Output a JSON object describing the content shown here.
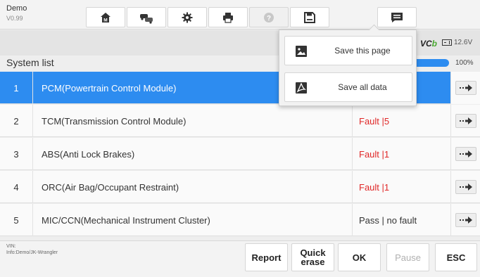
{
  "header": {
    "app_title": "Demo",
    "version": "V0.99",
    "toolbar": [
      {
        "name": "home-button",
        "icon": "home-icon"
      },
      {
        "name": "vehicle-swap-button",
        "icon": "vehicle-swap-icon"
      },
      {
        "name": "settings-button",
        "icon": "gear-icon"
      },
      {
        "name": "print-button",
        "icon": "printer-icon"
      },
      {
        "name": "help-button",
        "icon": "help-icon",
        "disabled": true
      },
      {
        "name": "save-button",
        "icon": "save-icon",
        "active": true
      },
      {
        "name": "message-button",
        "icon": "message-icon"
      }
    ]
  },
  "status": {
    "vci_label_vc": "VC",
    "vci_label_b": "b",
    "voltage": "12.6V",
    "progress_fraction": 1.0,
    "progress_text": "100%"
  },
  "section_title": "System list",
  "systems": [
    {
      "num": "1",
      "name": "PCM(Powertrain Control Module)",
      "status": "",
      "status_type": "",
      "selected": true
    },
    {
      "num": "2",
      "name": "TCM(Transmission Control Module)",
      "status": "Fault |5",
      "status_type": "fault",
      "selected": false
    },
    {
      "num": "3",
      "name": "ABS(Anti Lock Brakes)",
      "status": "Fault |1",
      "status_type": "fault",
      "selected": false
    },
    {
      "num": "4",
      "name": "ORC(Air Bag/Occupant Restraint)",
      "status": "Fault |1",
      "status_type": "fault",
      "selected": false
    },
    {
      "num": "5",
      "name": "MIC/CCN(Mechanical Instrument Cluster)",
      "status": "Pass | no fault",
      "status_type": "pass",
      "selected": false
    }
  ],
  "save_popup": {
    "save_page_label": "Save this page",
    "save_all_label": "Save all data"
  },
  "footer": {
    "vin_label": "VIN:",
    "info_label": "Info:Demo/JK-Wrangler",
    "buttons": {
      "report": "Report",
      "quick_erase_line1": "Quick",
      "quick_erase_line2": "erase",
      "ok": "OK",
      "pause": "Pause",
      "esc": "ESC"
    }
  },
  "colors": {
    "accent": "#2d8cf0",
    "fault": "#e02828",
    "vci_green": "#4aa832"
  }
}
